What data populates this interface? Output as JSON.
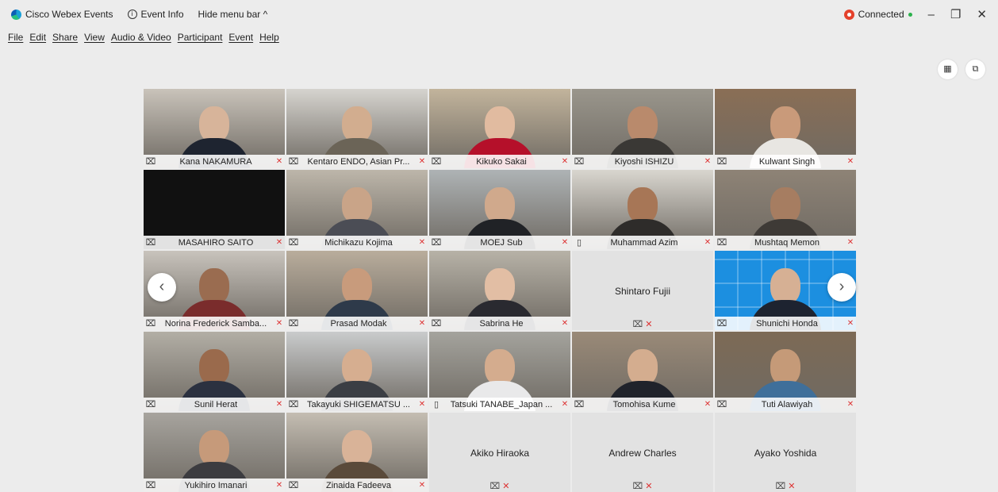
{
  "titlebar": {
    "app_name": "Cisco Webex Events",
    "event_info": "Event Info",
    "hide_menu": "Hide menu bar ^",
    "status": "Connected"
  },
  "menu": [
    "File",
    "Edit",
    "Share",
    "View",
    "Audio & Video",
    "Participant",
    "Event",
    "Help"
  ],
  "tiles": [
    {
      "name": "Kana NAKAMURA",
      "mic": "headset",
      "muted": true,
      "type": "photo",
      "bg": "#c9c3ba",
      "skin": "#d7b49a",
      "shirt": "#1e2430"
    },
    {
      "name": "Kentaro ENDO, Asian Pr...",
      "mic": "headset",
      "muted": true,
      "type": "photo",
      "bg": "#d6d4cf",
      "skin": "#d2ad8f",
      "shirt": "#6b6457"
    },
    {
      "name": "Kikuko Sakai",
      "mic": "headset",
      "muted": true,
      "type": "photo",
      "bg": "#c2b49c",
      "skin": "#e1bba0",
      "shirt": "#b5102a"
    },
    {
      "name": "Kiyoshi ISHIZU",
      "mic": "headset",
      "muted": true,
      "type": "photo",
      "bg": "#9a968c",
      "skin": "#b98a6c",
      "shirt": "#3a3835"
    },
    {
      "name": "Kulwant Singh",
      "mic": "headset",
      "muted": true,
      "type": "photo",
      "bg": "#8a6e55",
      "skin": "#c99a7a",
      "shirt": "#e8e6e2"
    },
    {
      "name": "MASAHIRO SAITO",
      "mic": "headset",
      "muted": true,
      "type": "dark"
    },
    {
      "name": "Michikazu Kojima",
      "mic": "headset",
      "muted": true,
      "type": "photo",
      "bg": "#bdb6aa",
      "skin": "#c9a488",
      "shirt": "#4b4d55"
    },
    {
      "name": "MOEJ Sub",
      "mic": "headset",
      "muted": true,
      "type": "photo",
      "bg": "#aeb3b5",
      "skin": "#d0a98c",
      "shirt": "#202226"
    },
    {
      "name": "Muhammad Azim",
      "mic": "phone",
      "muted": true,
      "type": "photo",
      "bg": "#d9d6cf",
      "skin": "#a77656",
      "shirt": "#2e2c2a"
    },
    {
      "name": "Mushtaq Memon",
      "mic": "headset",
      "muted": true,
      "type": "photo",
      "bg": "#8e8376",
      "skin": "#a67d61",
      "shirt": "#3e3a36"
    },
    {
      "name": "Norina Frederick Samba...",
      "mic": "headset",
      "muted": true,
      "type": "photo",
      "bg": "#c8c3bc",
      "skin": "#9a6c50",
      "shirt": "#7a2c2c"
    },
    {
      "name": "Prasad Modak",
      "mic": "headset",
      "muted": true,
      "type": "photo",
      "bg": "#b9ad9c",
      "skin": "#c89b7c",
      "shirt": "#2e3a4a"
    },
    {
      "name": "Sabrina He",
      "mic": "headset",
      "muted": true,
      "type": "photo",
      "bg": "#b7b2a7",
      "skin": "#e2bea4",
      "shirt": "#2a2a30"
    },
    {
      "name": "Shintaro Fujii",
      "mic": "headset",
      "muted": true,
      "type": "avatar"
    },
    {
      "name": "Shunichi Honda",
      "mic": "headset",
      "muted": true,
      "type": "blue",
      "skin": "#d6b094",
      "shirt": "#1d2330"
    },
    {
      "name": "Sunil Herat",
      "mic": "headset",
      "muted": true,
      "type": "photo",
      "bg": "#b2aea5",
      "skin": "#9a6a4c",
      "shirt": "#2b3140"
    },
    {
      "name": "Takayuki SHIGEMATSU ...",
      "mic": "headset",
      "muted": true,
      "type": "photo",
      "bg": "#c9cbcc",
      "skin": "#d6ae90",
      "shirt": "#3b3e44"
    },
    {
      "name": "Tatsuki TANABE_Japan ...",
      "mic": "phone",
      "muted": true,
      "type": "photo",
      "bg": "#a4a39d",
      "skin": "#d4ac8e",
      "shirt": "#e9e9ea"
    },
    {
      "name": "Tomohisa Kume",
      "mic": "headset",
      "muted": true,
      "type": "photo",
      "bg": "#9a8a78",
      "skin": "#d4ad8f",
      "shirt": "#20232b"
    },
    {
      "name": "Tuti Alawiyah",
      "mic": "headset",
      "muted": true,
      "type": "photo",
      "bg": "#7d6a55",
      "skin": "#c59a78",
      "shirt": "#3f6f9a"
    },
    {
      "name": "Yukihiro Imanari",
      "mic": "headset",
      "muted": true,
      "type": "photo",
      "bg": "#a7a49e",
      "skin": "#c69a7a",
      "shirt": "#3c3c40"
    },
    {
      "name": "Zinaida Fadeeva",
      "mic": "headset",
      "muted": true,
      "type": "photo",
      "bg": "#c4bdb2",
      "skin": "#d9b398",
      "shirt": "#5a4a3a"
    },
    {
      "name": "Akiko Hiraoka",
      "mic": "headset",
      "muted": true,
      "type": "avatar"
    },
    {
      "name": "Andrew Charles",
      "mic": "headset",
      "muted": true,
      "type": "avatar"
    },
    {
      "name": "Ayako Yoshida",
      "mic": "headset",
      "muted": true,
      "type": "avatar"
    }
  ],
  "icons": {
    "headset": "⌧",
    "phone": "▯",
    "mute": "✕",
    "prev": "‹",
    "next": "›"
  },
  "colors": {
    "muted_red": "#d33",
    "connected_green": "#2bb24c",
    "recording_red": "#e4412b"
  }
}
